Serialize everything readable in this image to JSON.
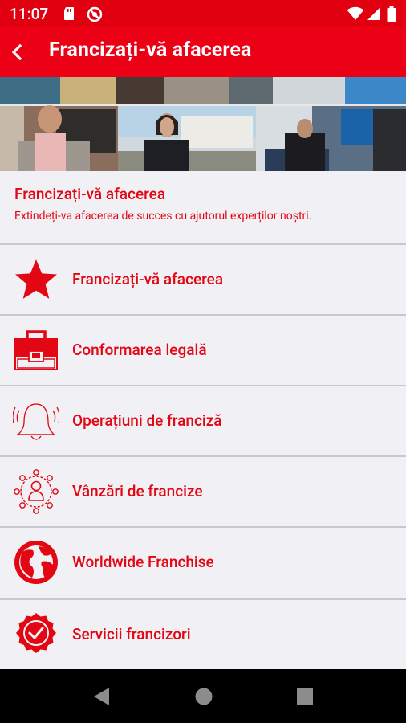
{
  "status_bar": {
    "time": "11:07"
  },
  "app_bar": {
    "title": "Francizați-vă afacerea"
  },
  "header": {
    "title": "Francizați-vă afacerea",
    "subtitle": "Extindeți-va afacerea de succes cu ajutorul experților noștri."
  },
  "menu": [
    {
      "label": "Francizați-vă afacerea",
      "icon": "star-icon"
    },
    {
      "label": "Conformarea legală",
      "icon": "briefcase-icon"
    },
    {
      "label": "Operațiuni de franciză",
      "icon": "bell-icon"
    },
    {
      "label": "Vânzări de francize",
      "icon": "network-icon"
    },
    {
      "label": "Worldwide Franchise",
      "icon": "globe-icon"
    },
    {
      "label": "Servicii francizori",
      "icon": "badge-check-icon"
    }
  ],
  "colors": {
    "brand_red": "#e30613",
    "appbar_red": "#ec0016",
    "background": "#f1f1f5"
  }
}
